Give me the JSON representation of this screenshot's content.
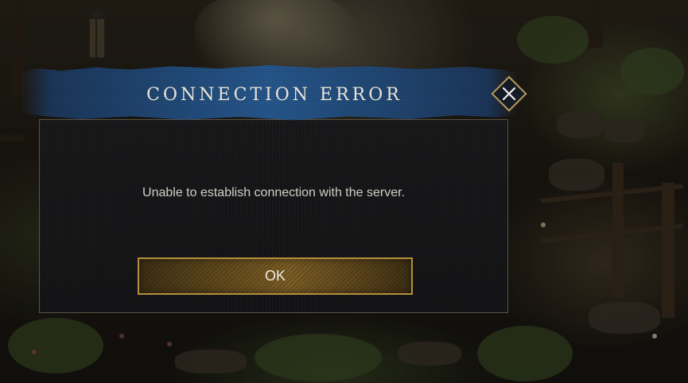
{
  "dialog": {
    "title": "CONNECTION ERROR",
    "message": "Unable to establish connection with the server.",
    "ok_label": "OK",
    "close_icon": "close-icon"
  },
  "colors": {
    "header_blue": "#1f4a7a",
    "title_text": "#e9e4d6",
    "button_gold": "#b38f3e",
    "button_fill": "#5e4619",
    "panel_bg": "#161618"
  }
}
